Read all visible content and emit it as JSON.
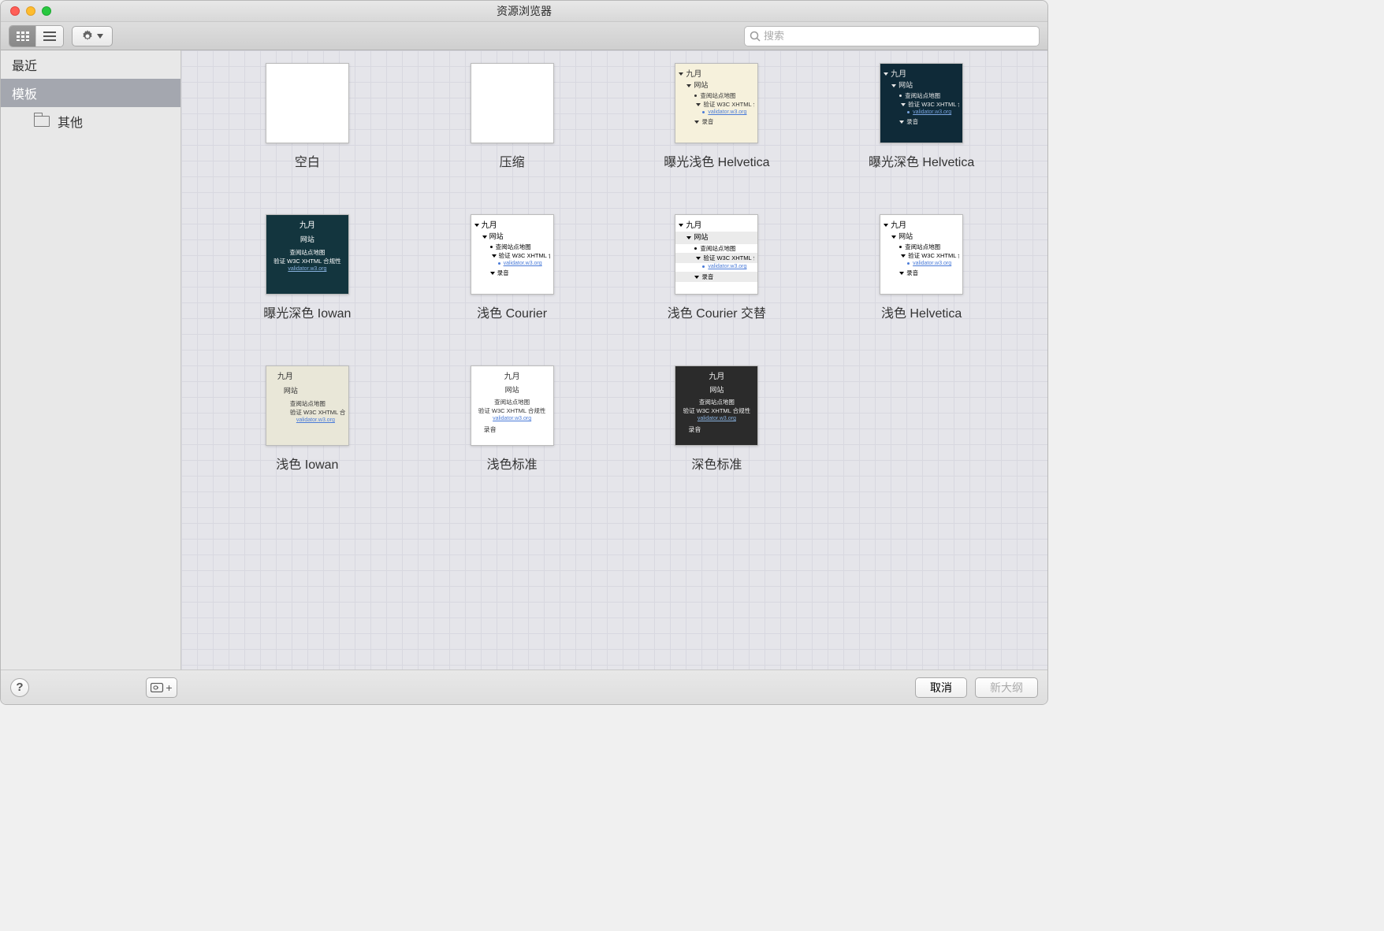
{
  "window": {
    "title": "资源浏览器"
  },
  "search": {
    "placeholder": "搜索"
  },
  "sidebar": {
    "recent": "最近",
    "templates": "模板",
    "other": "其他"
  },
  "preview": {
    "month": "九月",
    "site": "网站",
    "sitemap": "查阅站点地图",
    "validate": "验证 W3C XHTML 合规性",
    "validator_url": "validator.w3.org",
    "recording": "录音"
  },
  "templates": [
    {
      "label": "空白",
      "kind": "blank"
    },
    {
      "label": "压缩",
      "kind": "blank"
    },
    {
      "label": "曝光浅色 Helvetica",
      "kind": "light-beige-outline"
    },
    {
      "label": "曝光深色 Helvetica",
      "kind": "dark-navy-outline"
    },
    {
      "label": "曝光深色 Iowan",
      "kind": "dark-teal-center"
    },
    {
      "label": "浅色 Courier",
      "kind": "light-outline"
    },
    {
      "label": "浅色 Courier 交替",
      "kind": "light-alternating"
    },
    {
      "label": "浅色 Helvetica",
      "kind": "light-outline"
    },
    {
      "label": "浅色 Iowan",
      "kind": "beige-center"
    },
    {
      "label": "浅色标准",
      "kind": "light-center"
    },
    {
      "label": "深色标准",
      "kind": "dark-gray-center"
    }
  ],
  "footer": {
    "cancel": "取消",
    "newOutline": "新大纲"
  }
}
